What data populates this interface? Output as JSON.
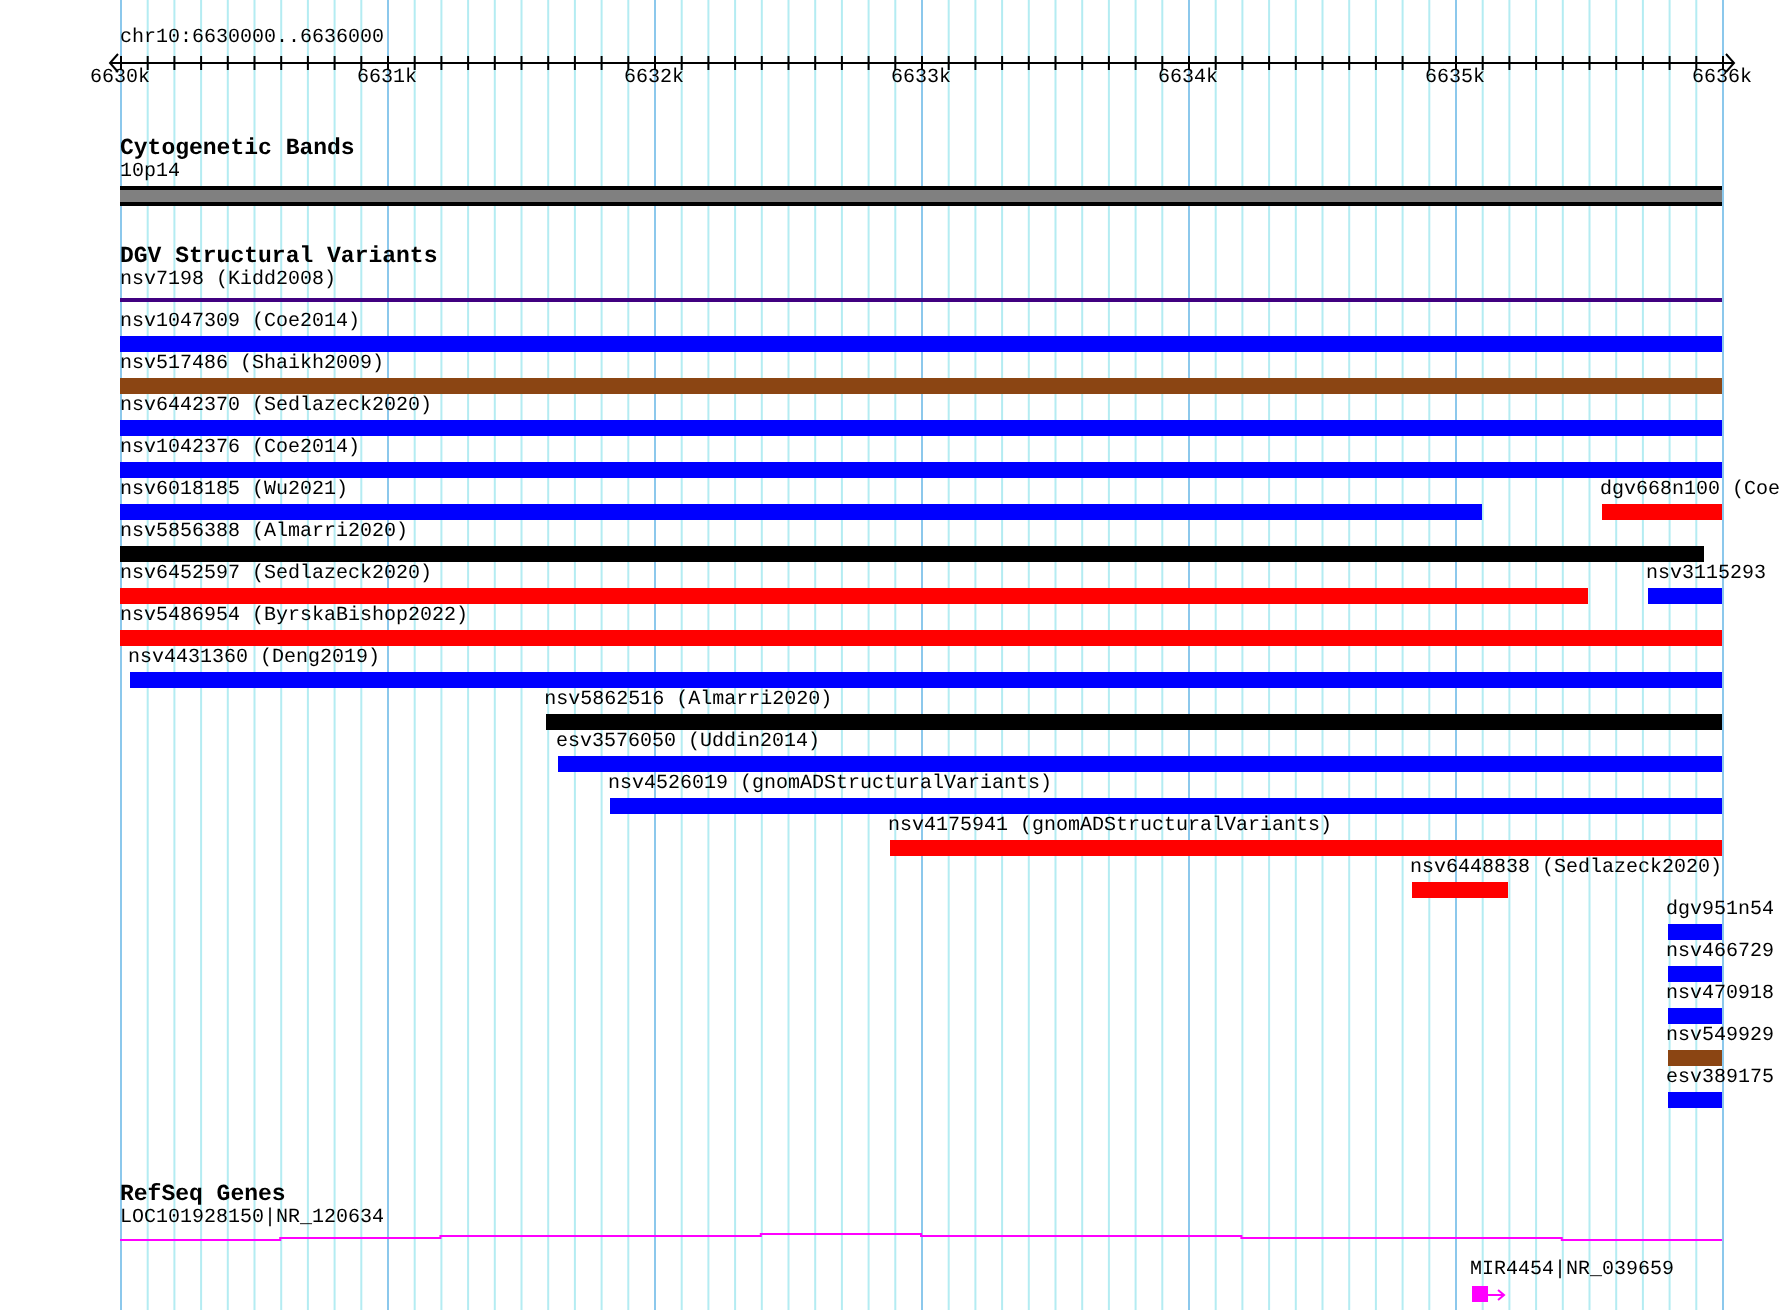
{
  "location": "chr10:6630000..6636000",
  "ruler": {
    "labels": [
      "6630k",
      "6631k",
      "6632k",
      "6633k",
      "6634k",
      "6635k",
      "6636k"
    ]
  },
  "cytogenetic_bands": {
    "title": "Cytogenetic Bands",
    "bands": [
      {
        "label": "10p14",
        "color": "#808080"
      }
    ]
  },
  "dgv": {
    "title": "DGV Structural Variants",
    "rows": [
      [
        {
          "label": "nsv7198 (Kidd2008)",
          "kind": "line",
          "color": "#400080"
        }
      ],
      [
        {
          "label": "nsv1047309 (Coe2014)",
          "kind": "bar",
          "color": "#0000ff"
        }
      ],
      [
        {
          "label": "nsv517486 (Shaikh2009)",
          "kind": "bar",
          "color": "#8b4513"
        }
      ],
      [
        {
          "label": "nsv6442370 (Sedlazeck2020)",
          "kind": "bar",
          "color": "#0000ff"
        }
      ],
      [
        {
          "label": "nsv1042376 (Coe2014)",
          "kind": "bar",
          "color": "#0000ff"
        }
      ],
      [
        {
          "label": "nsv6018185 (Wu2021)",
          "kind": "bar",
          "color": "#0000ff"
        },
        {
          "label": "dgv668n100 (Coe",
          "kind": "bar",
          "color": "#ff0000"
        }
      ],
      [
        {
          "label": "nsv5856388 (Almarri2020)",
          "kind": "bar",
          "color": "#000000"
        }
      ],
      [
        {
          "label": "nsv6452597 (Sedlazeck2020)",
          "kind": "bar",
          "color": "#ff0000"
        },
        {
          "label": "nsv3115293",
          "kind": "bar",
          "color": "#0000ff"
        }
      ],
      [
        {
          "label": "nsv5486954 (ByrskaBishop2022)",
          "kind": "bar",
          "color": "#ff0000"
        }
      ],
      [
        {
          "label": "nsv4431360 (Deng2019)",
          "kind": "bar",
          "color": "#0000ff"
        }
      ],
      [
        {
          "label": "nsv5862516 (Almarri2020)",
          "kind": "bar",
          "color": "#000000"
        }
      ],
      [
        {
          "label": "esv3576050 (Uddin2014)",
          "kind": "bar",
          "color": "#0000ff"
        }
      ],
      [
        {
          "label": "nsv4526019 (gnomADStructuralVariants)",
          "kind": "bar",
          "color": "#0000ff"
        }
      ],
      [
        {
          "label": "nsv4175941 (gnomADStructuralVariants)",
          "kind": "bar",
          "color": "#ff0000"
        }
      ],
      [
        {
          "label": "nsv6448838 (Sedlazeck2020)",
          "kind": "bar",
          "color": "#ff0000"
        }
      ],
      [
        {
          "label": "dgv951n54",
          "kind": "bar",
          "color": "#0000ff"
        }
      ],
      [
        {
          "label": "nsv466729",
          "kind": "bar",
          "color": "#0000ff"
        }
      ],
      [
        {
          "label": "nsv470918",
          "kind": "bar",
          "color": "#0000ff"
        }
      ],
      [
        {
          "label": "nsv549929",
          "kind": "bar",
          "color": "#8b4513"
        }
      ],
      [
        {
          "label": "esv389175",
          "kind": "bar",
          "color": "#0000ff"
        }
      ]
    ]
  },
  "refseq": {
    "title": "RefSeq Genes",
    "rows": [
      [
        {
          "label": "LOC101928150|NR_120634",
          "kind": "intron"
        }
      ],
      [
        {
          "label": "MIR4454|NR_039659",
          "kind": "exon"
        }
      ]
    ]
  }
}
